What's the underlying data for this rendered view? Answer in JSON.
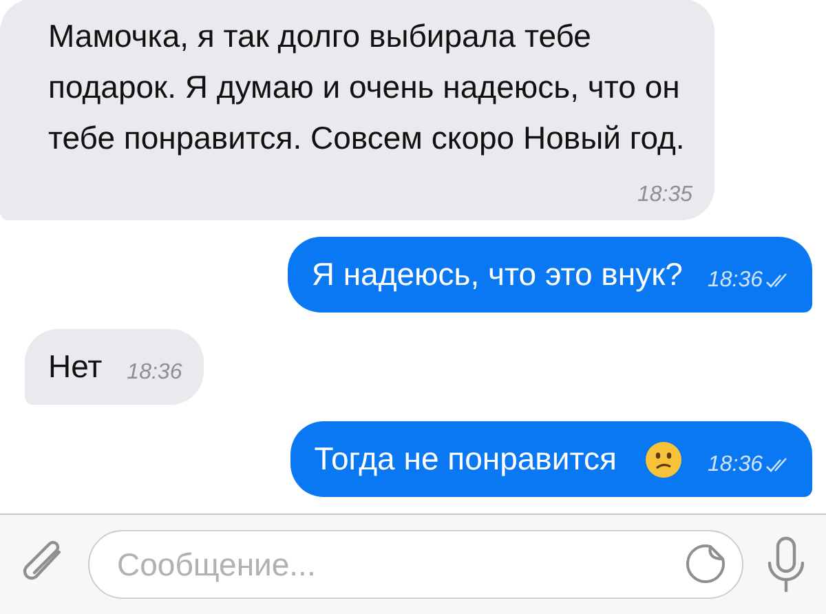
{
  "messages": [
    {
      "kind": "in",
      "text": "Мамочка, я так долго выбирала тебе подарок. Я думаю и очень надеюсь, что он тебе понравится. Совсем скоро Новый год.",
      "time": "18:35",
      "emoji": false
    },
    {
      "kind": "out",
      "text": "Я надеюсь, что это внук?",
      "time": "18:36",
      "read": true,
      "emoji": false
    },
    {
      "kind": "in",
      "text": "Нет",
      "time": "18:36",
      "emoji": false
    },
    {
      "kind": "out",
      "text": "Тогда не понравится",
      "time": "18:36",
      "read": true,
      "emoji": true
    }
  ],
  "composer": {
    "placeholder": "Сообщение..."
  }
}
